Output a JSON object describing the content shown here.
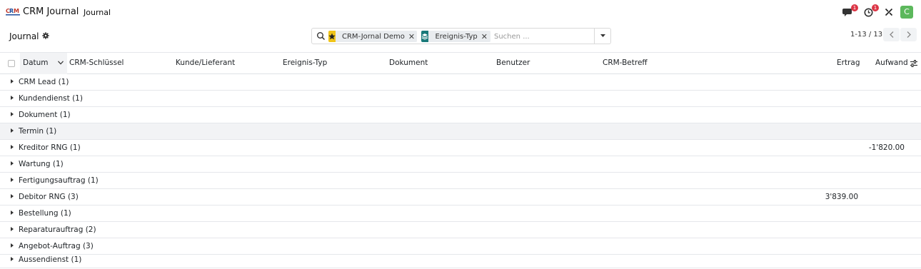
{
  "navbar": {
    "app_title": "CRM Journal",
    "menu_item": "Journal",
    "messages_badge": "1",
    "activities_badge": "1",
    "avatar_initial": "C",
    "colors": {
      "badge": "#dc3545",
      "avatar": "#5cb85c"
    }
  },
  "control_panel": {
    "title": "Journal",
    "search": {
      "facets": [
        {
          "icon": "star-icon",
          "label": "CRM-Jornal Demo",
          "icon_bg": "#f0c419"
        },
        {
          "icon": "layers-icon",
          "label": "Ereignis-Typ",
          "icon_bg": "#1a7a7a"
        }
      ],
      "placeholder": "Suchen ..."
    },
    "pager": {
      "value": "1-13 / 13"
    }
  },
  "table": {
    "columns": [
      {
        "key": "datum",
        "label": "Datum"
      },
      {
        "key": "crm_key",
        "label": "CRM-Schlüssel"
      },
      {
        "key": "partner",
        "label": "Kunde/Lieferant"
      },
      {
        "key": "event_type",
        "label": "Ereignis-Typ"
      },
      {
        "key": "document",
        "label": "Dokument"
      },
      {
        "key": "user",
        "label": "Benutzer"
      },
      {
        "key": "subject",
        "label": "CRM-Betreff"
      },
      {
        "key": "income",
        "label": "Ertrag"
      },
      {
        "key": "expense",
        "label": "Aufwand"
      }
    ],
    "groups": [
      {
        "label": "CRM Lead (1)",
        "income": "",
        "expense": ""
      },
      {
        "label": "Kundendienst (1)",
        "income": "",
        "expense": ""
      },
      {
        "label": "Dokument (1)",
        "income": "",
        "expense": ""
      },
      {
        "label": "Termin (1)",
        "income": "",
        "expense": "",
        "highlighted": true
      },
      {
        "label": "Kreditor RNG (1)",
        "income": "",
        "expense": "-1'820.00"
      },
      {
        "label": "Wartung (1)",
        "income": "",
        "expense": ""
      },
      {
        "label": "Fertigungsauftrag (1)",
        "income": "",
        "expense": ""
      },
      {
        "label": "Debitor RNG (3)",
        "income": "3'839.00",
        "expense": ""
      },
      {
        "label": "Bestellung (1)",
        "income": "",
        "expense": ""
      },
      {
        "label": "Reparaturauftrag (2)",
        "income": "",
        "expense": ""
      },
      {
        "label": "Angebot-Auftrag (3)",
        "income": "",
        "expense": ""
      },
      {
        "label": "Aussendienst (1)",
        "income": "",
        "expense": ""
      }
    ]
  }
}
